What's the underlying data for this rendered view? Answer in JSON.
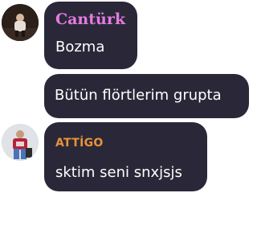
{
  "messages": [
    {
      "sender": "Cantürk",
      "sender_color": "#e57be0",
      "text": "Bozma",
      "avatar_icon": "user-avatar-photo"
    },
    {
      "sender": "",
      "text": "Bütün flörtlerim grupta"
    },
    {
      "sender": "ATTİGO",
      "sender_color": "#e8923a",
      "text": "sktim seni snxjsjs",
      "avatar_icon": "user-avatar-photo"
    }
  ],
  "colors": {
    "bubble_background": "#2a2838",
    "message_text": "#ffffff",
    "page_background": "#ffffff"
  }
}
